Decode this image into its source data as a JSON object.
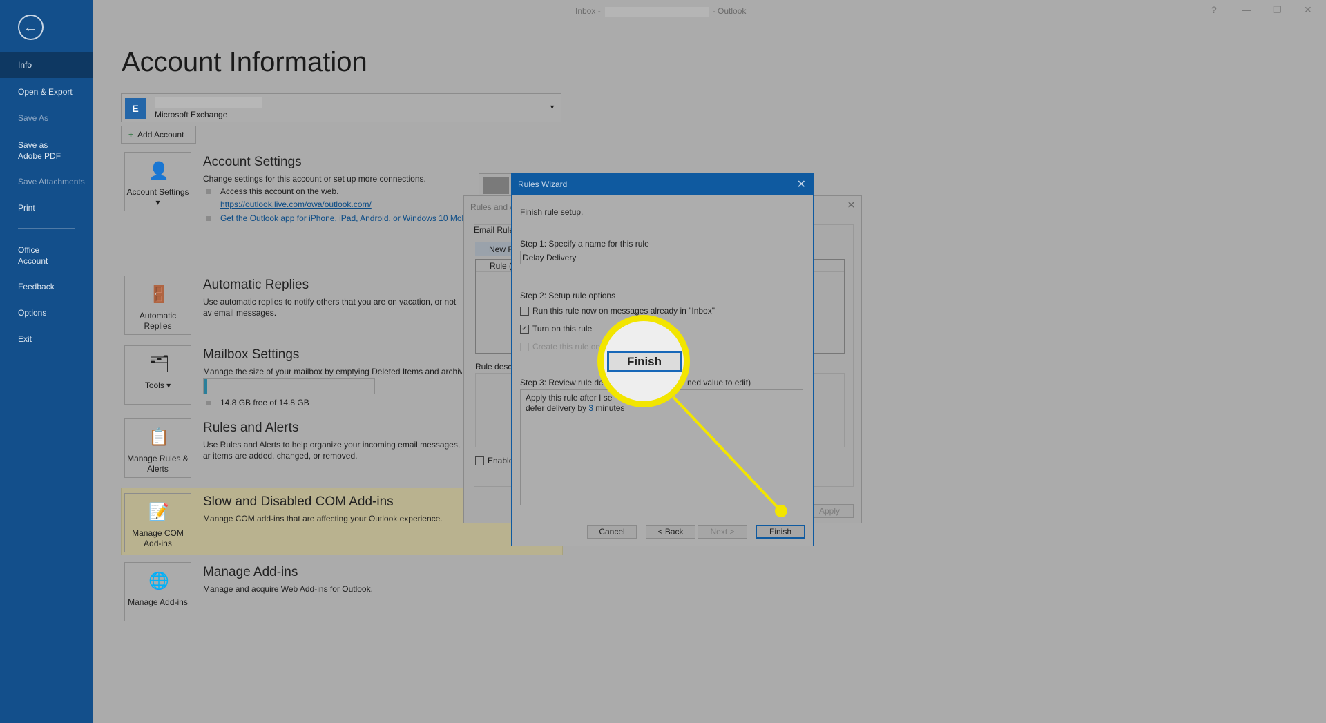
{
  "window": {
    "title_prefix": "Inbox -",
    "title_suffix": "- Outlook",
    "help": "?",
    "minimize": "—",
    "restore": "❐",
    "close": "✕"
  },
  "sidebar": {
    "back": "←",
    "items": [
      {
        "label": "Info",
        "selected": true
      },
      {
        "label": "Open & Export"
      },
      {
        "label": "Save As",
        "disabled": true
      },
      {
        "label": "Save as Adobe PDF"
      },
      {
        "label": "Save Attachments",
        "disabled": true
      },
      {
        "label": "Print"
      },
      {
        "label": "Office Account"
      },
      {
        "label": "Feedback"
      },
      {
        "label": "Options"
      },
      {
        "label": "Exit"
      }
    ]
  },
  "main": {
    "title": "Account Information",
    "account_type": "Microsoft Exchange",
    "add_account": "Add Account",
    "sections": [
      {
        "tile": "Account Settings ▾",
        "title": "Account Settings",
        "desc": "Change settings for this account or set up more connections.",
        "bullet1": "Access this account on the web.",
        "link1": "https://outlook.live.com/owa/outlook.com/",
        "link2": "Get the Outlook app for iPhone, iPad, Android, or Windows 10 Mob"
      },
      {
        "tile": "Automatic Replies",
        "title": "Automatic Replies",
        "desc": "Use automatic replies to notify others that you are on vacation, or not av email messages."
      },
      {
        "tile": "Tools ▾",
        "title": "Mailbox Settings",
        "desc": "Manage the size of your mailbox by emptying Deleted Items and archivi",
        "storage": "14.8 GB free of 14.8 GB",
        "usage_percent": 2
      },
      {
        "tile": "Manage Rules & Alerts",
        "title": "Rules and Alerts",
        "desc": "Use Rules and Alerts to help organize your incoming email messages, ar items are added, changed, or removed."
      },
      {
        "tile": "Manage COM Add-ins",
        "title": "Slow and Disabled COM Add-ins",
        "desc": "Manage COM add-ins that are affecting your Outlook experience."
      },
      {
        "tile": "Manage Add-ins",
        "title": "Manage Add-ins",
        "desc": "Manage and acquire Web Add-ins for Outlook."
      }
    ]
  },
  "rules_alerts": {
    "title": "Rules and A",
    "tab": "Email Rule",
    "new_rule": "New R",
    "col": "Rule (",
    "desc_label": "Rule descr",
    "enable": "Enable",
    "apply": "Apply",
    "close": "✕"
  },
  "wizard": {
    "title": "Rules Wizard",
    "close": "✕",
    "heading": "Finish rule setup.",
    "step1": "Step 1: Specify a name for this rule",
    "name_value": "Delay Delivery",
    "step2": "Step 2: Setup rule options",
    "opt1": {
      "label": "Run this rule now on messages already in \"Inbox\"",
      "checked": false
    },
    "opt2": {
      "label": "Turn on this rule",
      "checked": true
    },
    "opt3": {
      "label": "Create this rule on",
      "checked": false,
      "disabled": true
    },
    "step3": "Step 3: Review rule des",
    "step3_end": "ned value to edit)",
    "desc_line1": "Apply this rule after I se",
    "desc_line2_pre": "defer delivery by ",
    "desc_value": "3",
    "desc_line2_post": " minutes",
    "cancel": "Cancel",
    "back": "< Back",
    "next": "Next >",
    "finish": "Finish"
  },
  "callout": {
    "label": "Finish",
    "color": "#f2e500"
  }
}
